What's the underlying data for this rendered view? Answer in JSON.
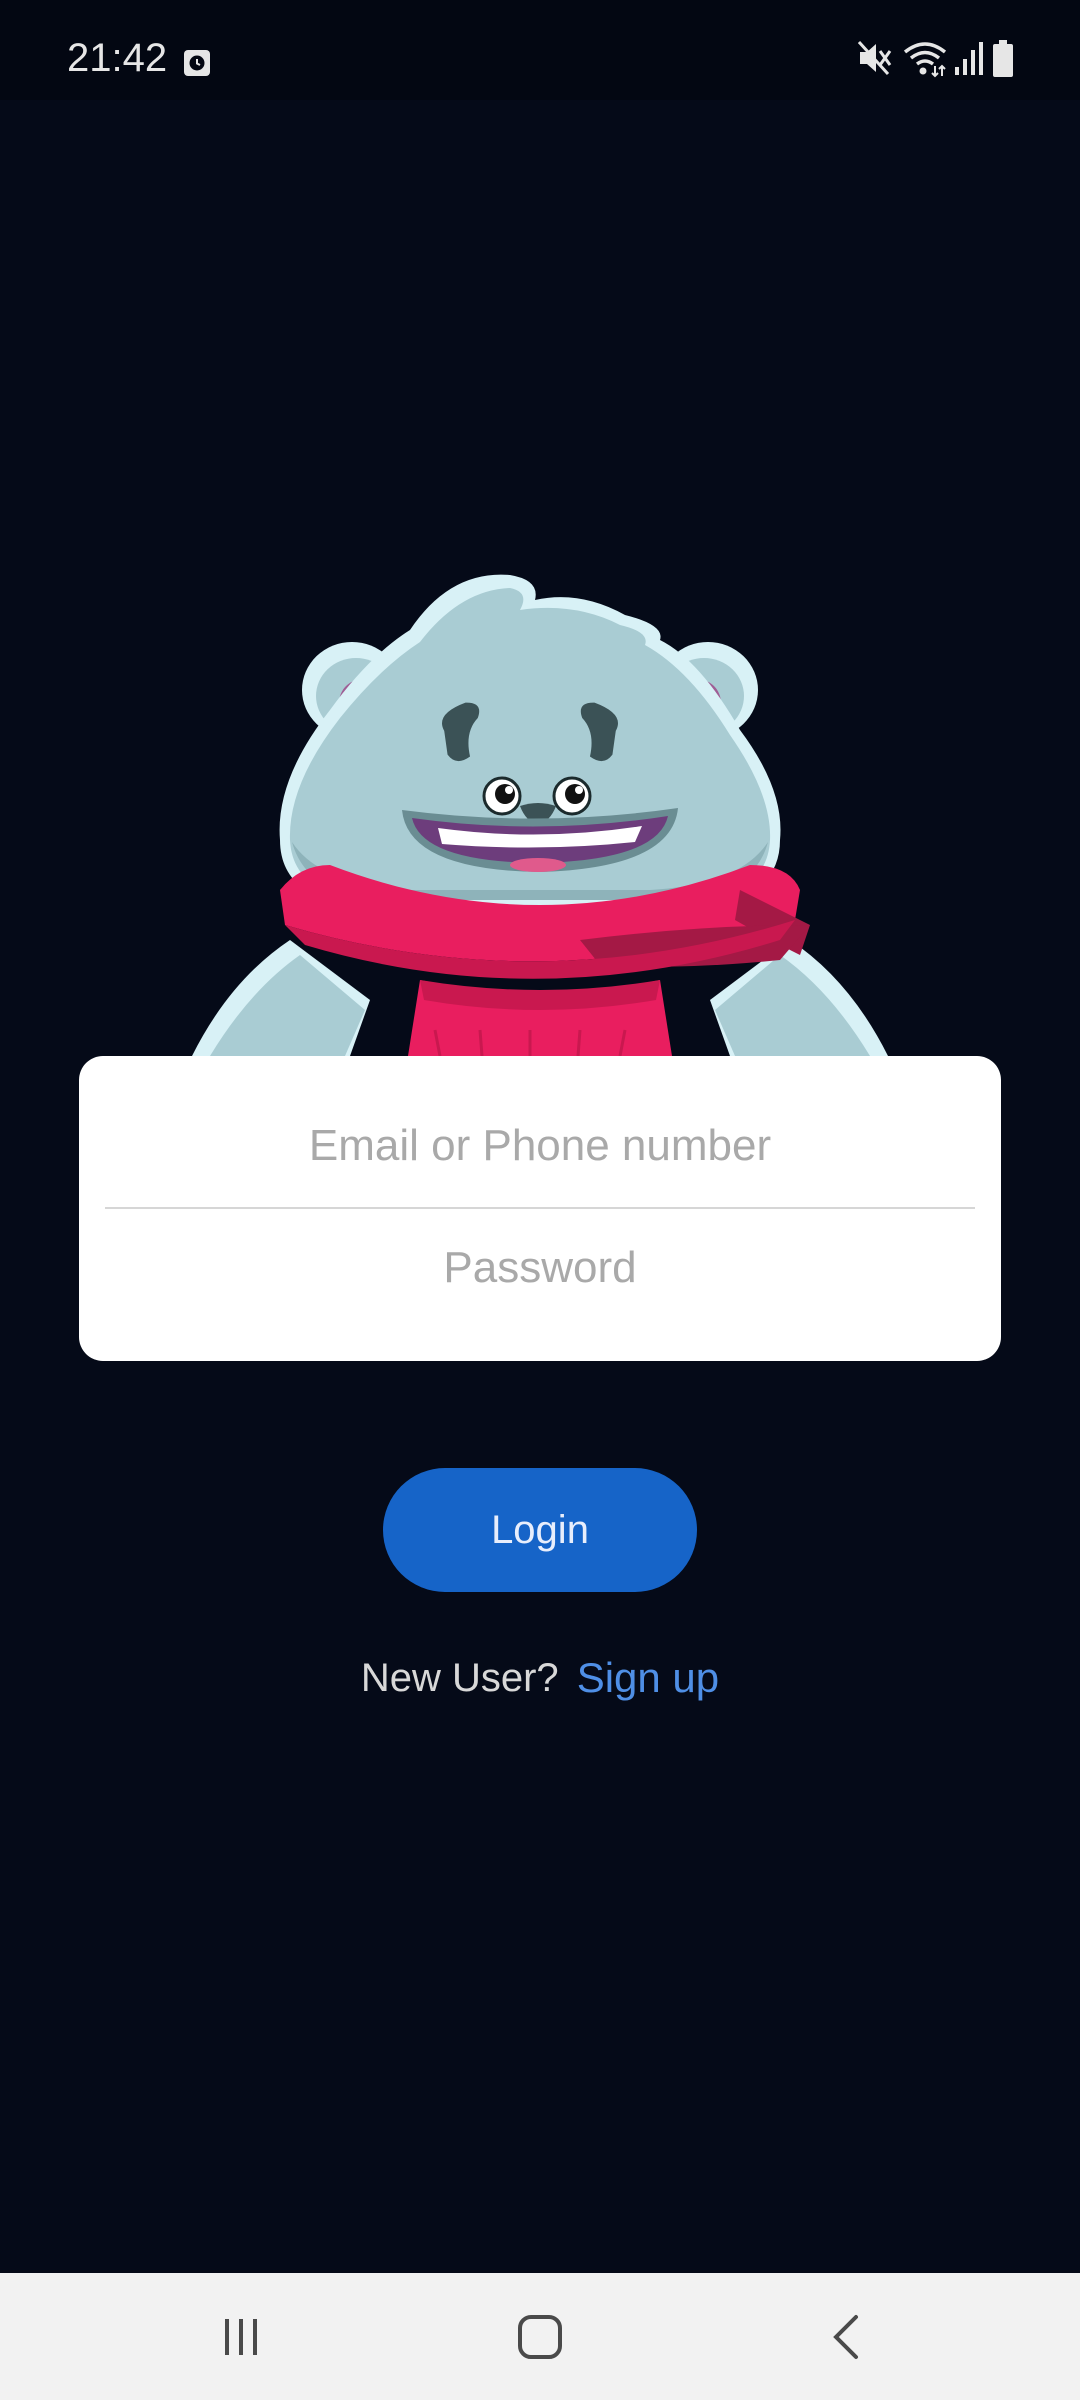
{
  "status_bar": {
    "time": "21:42",
    "left_icons": [
      "alarm-icon"
    ],
    "right_icons": [
      "mute-icon",
      "wifi-icon",
      "signal-icon",
      "battery-icon"
    ]
  },
  "mascot": {
    "icon": "bear-mascot-illustration"
  },
  "login_form": {
    "email_placeholder": "Email or Phone number",
    "email_value": "",
    "password_placeholder": "Password",
    "password_value": ""
  },
  "login_button": {
    "label": "Login"
  },
  "signup": {
    "question": "New User?",
    "link_label": "Sign up"
  },
  "nav_bar": {
    "icons": [
      "recents-icon",
      "home-icon",
      "back-icon"
    ]
  },
  "colors": {
    "background": "#050a18",
    "card": "#ffffff",
    "button": "#1664c8",
    "link": "#4f8fe6",
    "scarf": "#e91e5f",
    "bear_fur": "#a9ccd3"
  }
}
